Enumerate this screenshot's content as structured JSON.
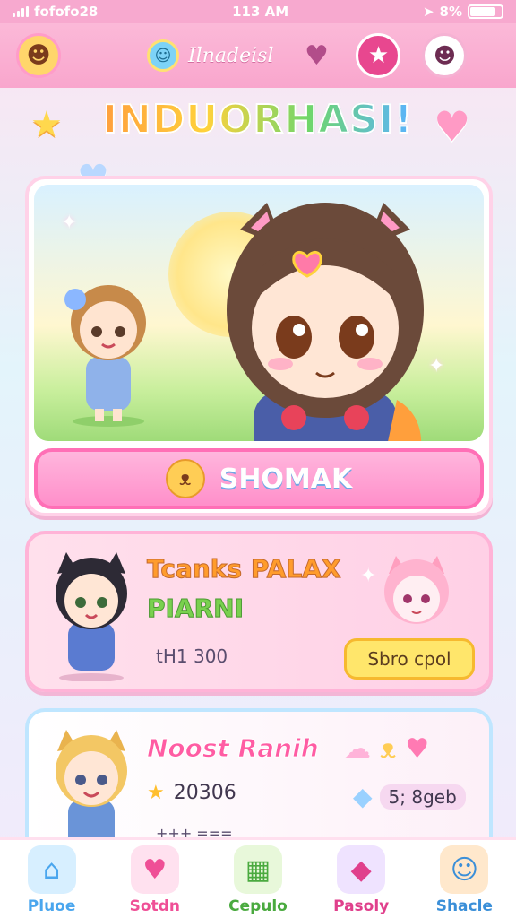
{
  "status": {
    "carrier": "fofofo28",
    "time": "113 AM",
    "battery": "8%",
    "battery_level": 0.82
  },
  "header": {
    "title": "Ilnadeisl",
    "logo_icon": "smiley-face-icon",
    "left_icon": "sun-face-icon",
    "heart_icon": "heart-icon",
    "star_icon": "star-icon",
    "face_icon": "face-icon"
  },
  "banner": {
    "title": "INDUORHASI!"
  },
  "hero": {
    "button_label": "SHOMAK",
    "button_icon": "bear-icon"
  },
  "cards": [
    {
      "title_line1": "Tcanks PALAX",
      "title_line2": "PIARNI",
      "price": "tH1 300",
      "action_label": "Sbro cpol"
    },
    {
      "title_line1": "Noost Ranih",
      "score": "20306",
      "side_value": "5; 8geb",
      "footer": "+++ ==="
    }
  ],
  "tabs": [
    {
      "label": "Pluoe",
      "icon": "house-icon",
      "color": "#4aa6ee",
      "bg": "#d7efff",
      "glyph": "⌂"
    },
    {
      "label": "Sotdn",
      "icon": "heart-icon",
      "color": "#ef4f96",
      "bg": "#ffe1ef",
      "glyph": "♥"
    },
    {
      "label": "Cepulo",
      "icon": "shop-icon",
      "color": "#4aaa3f",
      "bg": "#e8f8da",
      "glyph": "▦"
    },
    {
      "label": "Pasoly",
      "icon": "gift-icon",
      "color": "#e0408c",
      "bg": "#efe3ff",
      "glyph": "◆"
    },
    {
      "label": "Shacle",
      "icon": "bear-face-icon",
      "color": "#3b8fd8",
      "bg": "#ffe8cc",
      "glyph": "☺"
    }
  ]
}
